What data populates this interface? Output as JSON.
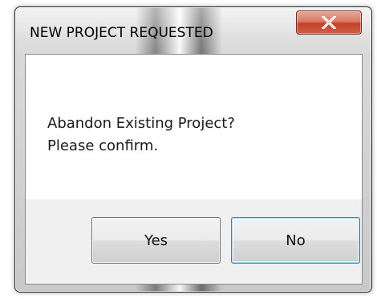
{
  "dialog": {
    "title": "NEW PROJECT REQUESTED",
    "message_line1": "Abandon Existing Project?",
    "message_line2": "Please confirm.",
    "close_icon": "close-x-icon",
    "buttons": {
      "yes_label": "Yes",
      "no_label": "No"
    },
    "colors": {
      "close_button": "#c2412a",
      "default_button_border": "#3c7fb1",
      "client_background": "#ffffff",
      "button_bar_background": "#f0f0f0"
    }
  }
}
